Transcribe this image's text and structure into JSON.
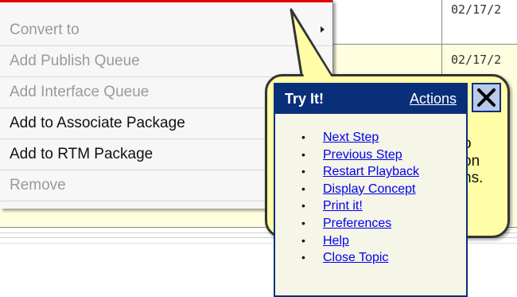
{
  "background": {
    "dates": [
      "02/17/2",
      "02/17/2"
    ],
    "partial_text": [
      "o",
      "on",
      "ns."
    ]
  },
  "context_menu": {
    "items": [
      {
        "label": "Convert to",
        "enabled": false,
        "has_submenu": true
      },
      {
        "label": "Add Publish Queue",
        "enabled": false
      },
      {
        "label": "Add Interface Queue",
        "enabled": false
      },
      {
        "label": "Add to Associate Package",
        "enabled": true
      },
      {
        "label": "Add to RTM Package",
        "enabled": true
      },
      {
        "label": "Remove",
        "enabled": false
      }
    ]
  },
  "try_it": {
    "title": "Try It!",
    "actions_label": "Actions",
    "close_icon": "close-icon",
    "links": [
      "Next Step",
      "Previous Step",
      "Restart Playback",
      "Display Concept",
      "Print it!",
      "Preferences",
      "Help",
      "Close Topic"
    ]
  },
  "colors": {
    "accent_red": "#e60000",
    "panel_navy": "#0a2f7a",
    "highlight_yellow": "#fffea6",
    "link_blue": "#0000ee"
  }
}
